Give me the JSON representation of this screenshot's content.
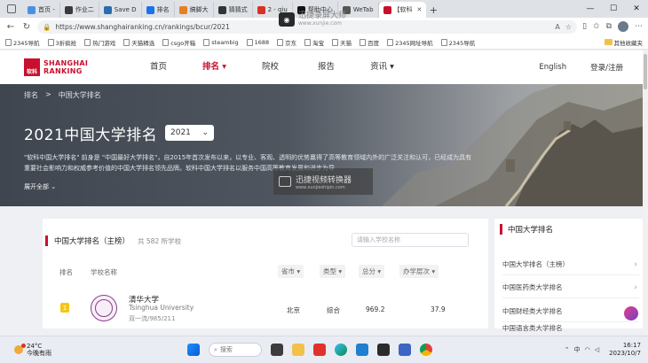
{
  "browser": {
    "tabs": [
      {
        "label": "首页 -",
        "color": "#4a90e2"
      },
      {
        "label": "作业二",
        "color": "#3a3a3a"
      },
      {
        "label": "Save D",
        "color": "#2b6cb0"
      },
      {
        "label": "排名",
        "color": "#1a73e8"
      },
      {
        "label": "搞脚大",
        "color": "#e67e22"
      },
      {
        "label": "猜猜式",
        "color": "#333333"
      },
      {
        "label": "2 - qiu",
        "color": "#d93025"
      },
      {
        "label": "帮助中心",
        "color": "#111111"
      },
      {
        "label": "WeTab",
        "color": "#555555"
      },
      {
        "label": "【软科",
        "color": "#c8102e"
      }
    ],
    "url": "https://www.shanghairanking.cn/rankings/bcur/2021",
    "bookmarks": [
      "2345导航",
      "3折疯抢",
      "热门游戏",
      "天猫精选",
      "csgo开箱",
      "steambig",
      "1688",
      "京东",
      "淘宝",
      "天猫",
      "百度",
      "2345网址导航",
      "2345导航"
    ],
    "other_bookmarks": "其他收藏夹",
    "recorder": {
      "title": "迅捷录屏大师",
      "sub": "www.xunjie.com"
    }
  },
  "site": {
    "logo_line1": "SHANGHAI",
    "logo_line2": "RANKING",
    "logo_badge": "软科",
    "nav": [
      {
        "label": "首页"
      },
      {
        "label": "排名 ▾"
      },
      {
        "label": "院校"
      },
      {
        "label": "报告"
      },
      {
        "label": "资讯 ▾"
      }
    ],
    "lang": "English",
    "login": "登录/注册"
  },
  "hero": {
    "breadcrumb_home": "排名",
    "breadcrumb_sep": ">",
    "breadcrumb_current": "中国大学排名",
    "title": "2021中国大学排名",
    "year": "2021",
    "desc": "\"软科中国大学排名\" 前身是 \"中国最好大学排名\"，自2015年首次发布以来，以专业、客观、透明的优势赢得了高等教育领域内外的广泛关注和认可，已经成为具有重要社会影响力和权威参考价值的中国大学排名领先品牌。软科中国大学排名以服务中国高等教育发展和进步为导",
    "expand": "展开全部 ⌄",
    "watermark_title": "迅捷视频转换器",
    "watermark_sub": "www.xunjieshipin.com"
  },
  "ranking": {
    "title": "中国大学排名（主榜）",
    "count": "共 582 所学校",
    "search_placeholder": "请输入学校名称",
    "headers": {
      "rank": "排名",
      "name": "学校名称",
      "province": "省市 ▾",
      "type": "类型 ▾",
      "score": "总分 ▾",
      "level": "办学层次 ▾"
    },
    "rows": [
      {
        "rank": "1",
        "name": "清华大学",
        "name_en": "Tsinghua University",
        "tags": "双一流/985/211",
        "province": "北京",
        "type": "综合",
        "score": "969.2",
        "level": "37.9"
      }
    ]
  },
  "side": {
    "title": "中国大学排名",
    "items": [
      "中国大学排名（主榜）",
      "中国医药类大学排名",
      "中国财经类大学排名",
      "中国语言类大学排名"
    ]
  },
  "taskbar": {
    "temp": "24°C",
    "weather": "今晚有雨",
    "search": "搜索",
    "lang_indicator": "中",
    "time": "16:17",
    "date": "2023/10/7"
  }
}
